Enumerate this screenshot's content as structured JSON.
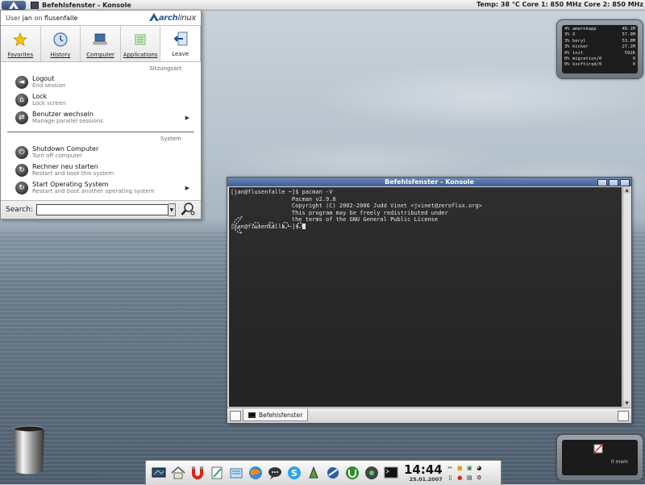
{
  "topbar": {
    "window_title": "Befehlsfenster - Konsole",
    "sys_info": "Temp: 38 °C   Core 1: 850 MHz   Core 2: 850 MHz"
  },
  "kickoff": {
    "user_prefix": "User",
    "user": "jan",
    "on": "on",
    "host": "flusenfalle",
    "logo_bold": "arch",
    "logo_rest": "linux",
    "tabs": [
      {
        "label": "Favorites"
      },
      {
        "label": "History"
      },
      {
        "label": "Computer"
      },
      {
        "label": "Applications"
      },
      {
        "label": "Leave"
      }
    ],
    "section_session": "Sitzungsart",
    "section_system": "System",
    "session_items": [
      {
        "title": "Logout",
        "subtitle": "End session"
      },
      {
        "title": "Lock",
        "subtitle": "Lock screen"
      },
      {
        "title": "Benutzer wechseln",
        "subtitle": "Manage parallel sessions"
      }
    ],
    "system_items": [
      {
        "title": "Shutdown Computer",
        "subtitle": "Turn off computer"
      },
      {
        "title": "Rechner neu starten",
        "subtitle": "Restart and boot this system"
      },
      {
        "title": "Start Operating System",
        "subtitle": "Restart and boot another operating system"
      }
    ],
    "search_label": "Search:",
    "search_value": ""
  },
  "procmon": {
    "rows": [
      {
        "pct": "4%",
        "name": "amarokapp",
        "mem": "48.1M"
      },
      {
        "pct": "3%",
        "name": "X",
        "mem": "57.0M"
      },
      {
        "pct": "3%",
        "name": "beryl",
        "mem": "53.0M"
      },
      {
        "pct": "3%",
        "name": "kicker",
        "mem": "27.2M"
      },
      {
        "pct": "0%",
        "name": "init",
        "mem": "592K"
      },
      {
        "pct": "0%",
        "name": "migration/0",
        "mem": "0"
      },
      {
        "pct": "0%",
        "name": "ksoftirqd/0",
        "mem": "0"
      }
    ]
  },
  "konsole": {
    "title": "Befehlsfenster - Konsole",
    "lines": [
      "[jan@flusenfalle ~]$ pacman -V",
      "",
      "                  Pacman v2.9.8",
      "                  Copyright (C) 2002-2006 Judd Vinet <jvinet@zeroflux.org>",
      "",
      "                  This program may be freely redistributed under",
      "                  the terms of the GNU General Public License",
      "",
      "[jan@flusenfalle ~]$ "
    ],
    "session_tab": "Befehlsfenster"
  },
  "clock_widget": {
    "text": "0 mem"
  },
  "panel": {
    "time": "14:44",
    "date": "25.01.2007"
  }
}
